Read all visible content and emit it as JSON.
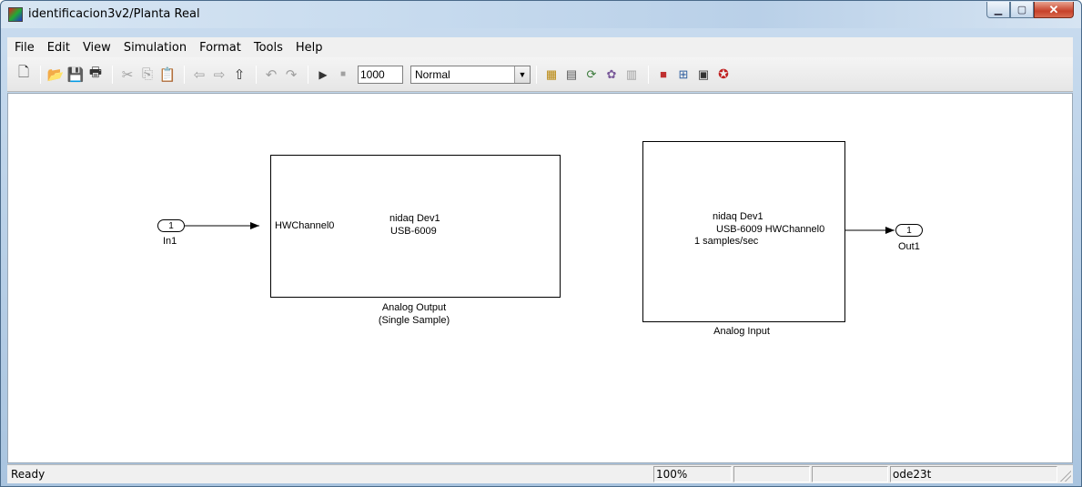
{
  "window": {
    "title": "identificacion3v2/Planta Real"
  },
  "menu": [
    "File",
    "Edit",
    "View",
    "Simulation",
    "Format",
    "Tools",
    "Help"
  ],
  "toolbar": {
    "stop_time": "1000",
    "sim_mode": "Normal"
  },
  "diagram": {
    "inport": {
      "number": "1",
      "name": "In1"
    },
    "analog_output": {
      "port": "HWChannel0",
      "line1": "nidaq Dev1",
      "line2": "USB-6009",
      "caption1": "Analog Output",
      "caption2": "(Single Sample)"
    },
    "analog_input": {
      "line1": "nidaq Dev1",
      "line2": "USB-6009  HWChannel0",
      "line3": "1 samples/sec",
      "caption": "Analog Input"
    },
    "outport": {
      "number": "1",
      "name": "Out1"
    }
  },
  "status": {
    "text": "Ready",
    "zoom": "100%",
    "solver": "ode23t"
  }
}
